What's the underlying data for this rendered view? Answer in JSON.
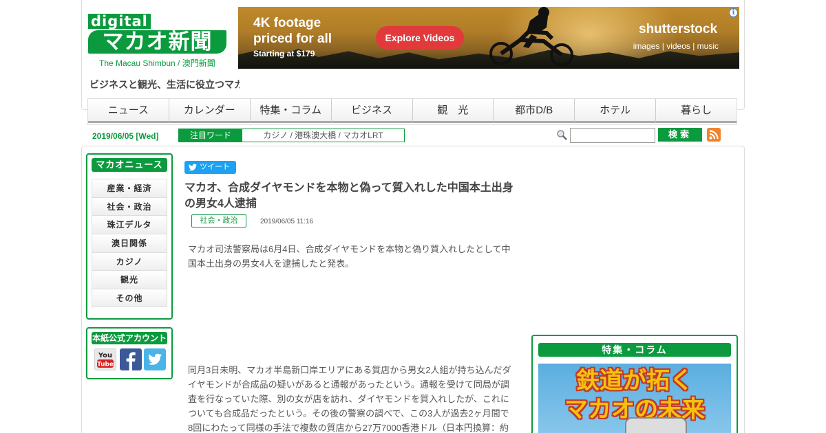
{
  "site": {
    "logo_digital": "digital",
    "logo_main": "マカオ新聞",
    "logo_sub": "The Macau Shimbun / 澳門新聞",
    "tagline": "ビジネスと観光、生活に役立つマカオ"
  },
  "ad": {
    "headline": "4K footage priced for all",
    "price": "Starting at $179",
    "button": "Explore Videos",
    "brand": "shutterstock",
    "links": "images  |  videos  |  music",
    "info_icon": "i",
    "colors": {
      "button": "#e23a3a",
      "info": "#3a86d8"
    }
  },
  "nav": {
    "items": [
      "ニュース",
      "カレンダー",
      "特集・コラム",
      "ビジネス",
      "観　光",
      "都市D/B",
      "ホテル",
      "暮らし"
    ]
  },
  "infobar": {
    "date": "2019/06/05 [Wed]",
    "keyword_label": "注目ワード",
    "keywords": "カジノ / 港珠澳大橋 / マカオLRT",
    "search_placeholder": "",
    "search_button": "検索"
  },
  "sidebar": {
    "title": "マカオニュース",
    "items": [
      "産業・経済",
      "社会・政治",
      "珠江デルタ",
      "澳日関係",
      "カジノ",
      "観光",
      "その他"
    ],
    "accounts_title": "本紙公式アカウント",
    "accounts": [
      "youtube",
      "facebook",
      "twitter"
    ]
  },
  "article": {
    "tweet": "ツイート",
    "title": "マカオ、合成ダイヤモンドを本物と偽って質入れした中国本土出身の男女4人逮捕",
    "category": "社会・政治",
    "datetime": "2019/06/05 11:16",
    "p1": "マカオ司法警察局は6月4日、合成ダイヤモンドを本物と偽り質入れしたとして中国本土出身の男女4人を逮捕したと発表。",
    "p2": "同月3日未明、マカオ半島新口岸エリアにある質店から男女2人組が持ち込んだダイヤモンドが合成品の疑いがあると通報があったという。通報を受けて同局が調査を行なっていた際、別の女が店を訪れ、ダイヤモンドを質入れしたが、これについても合成品だったという。その後の警察の調べで、この3人が過去2ヶ月間で8回にわたって同様の手法で複数の質店から27万7000香港ドル（日本円換算：約"
  },
  "feature": {
    "title": "特集・コラム",
    "image_text": "鉄道が拓く\nマカオの未来"
  },
  "colors": {
    "brand_green": "#0b9b3e",
    "rss": "#f3832b",
    "twitter": "#1da1f2"
  }
}
